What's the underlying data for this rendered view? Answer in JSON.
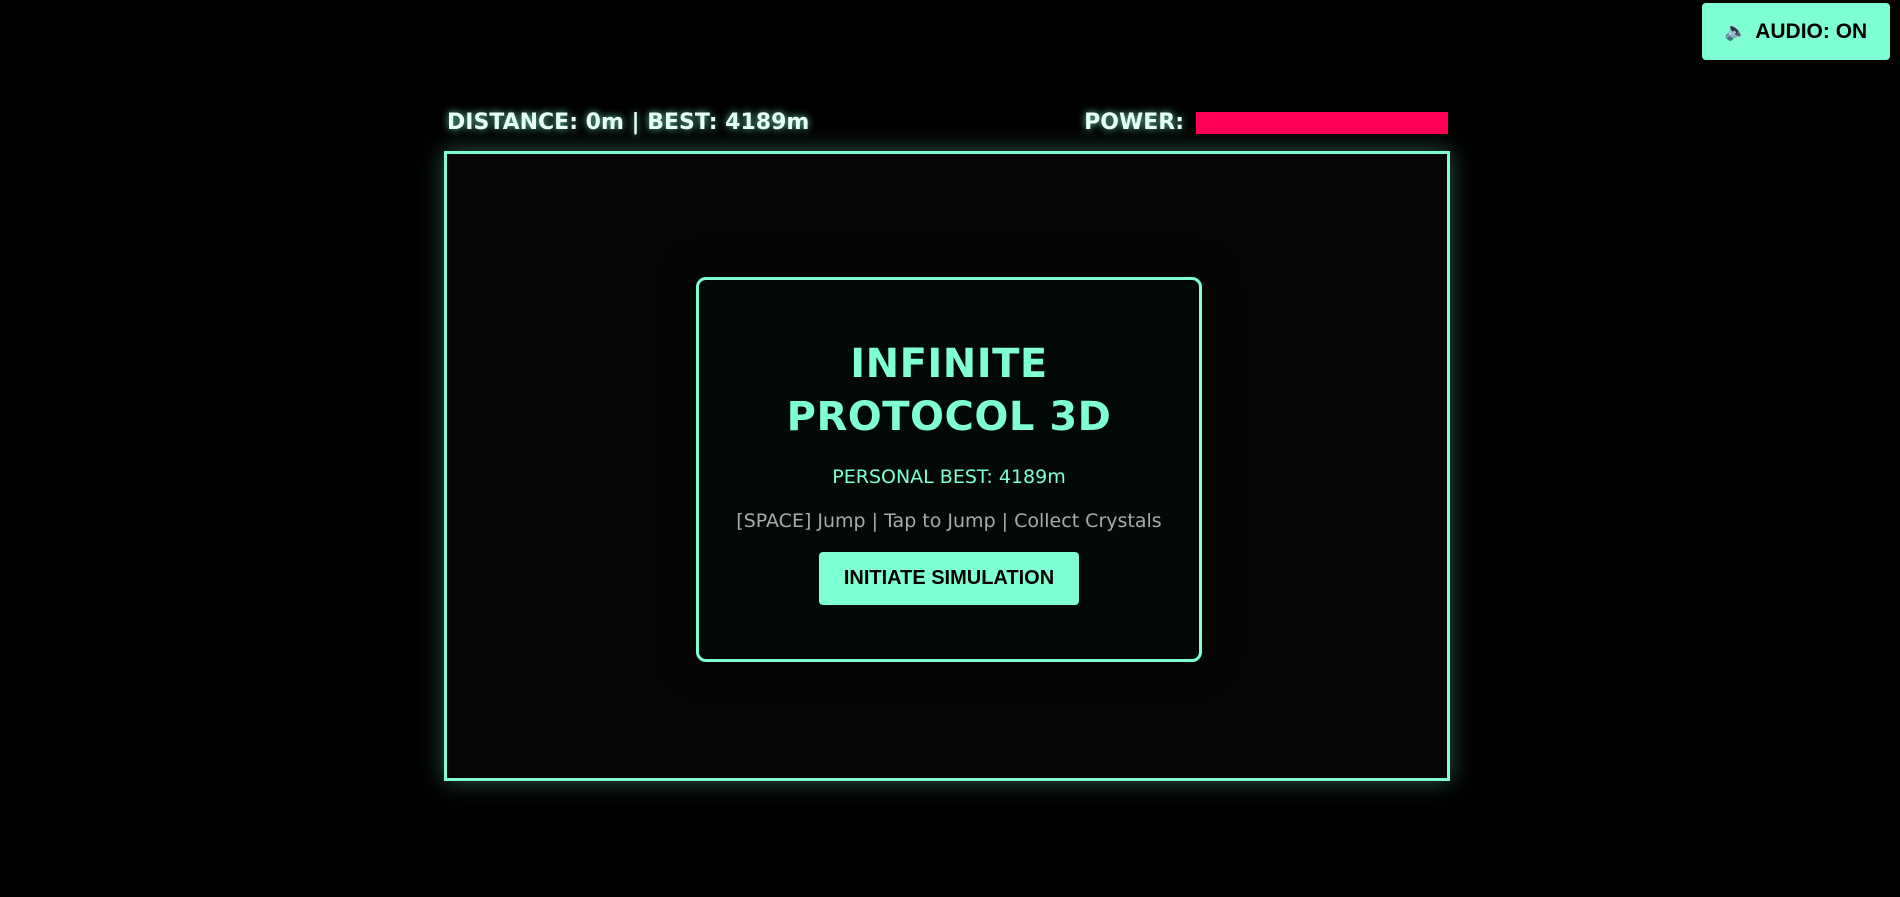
{
  "audio_button": {
    "icon": "speaker-icon",
    "label": "AUDIO: ON"
  },
  "hud": {
    "distance_text": "DISTANCE: 0m | BEST: 4189m",
    "power_label": "POWER:",
    "power_level": 1.0,
    "power_color": "#ff0055"
  },
  "menu": {
    "title": "INFINITE PROTOCOL 3D",
    "personal_best": "PERSONAL BEST: 4189m",
    "controls_hint": "[SPACE] Jump | Tap to Jump | Collect Crystals",
    "start_button": "INITIATE SIMULATION"
  },
  "colors": {
    "accent": "#7fffd4",
    "background": "#000000",
    "power_bar": "#ff0055"
  }
}
